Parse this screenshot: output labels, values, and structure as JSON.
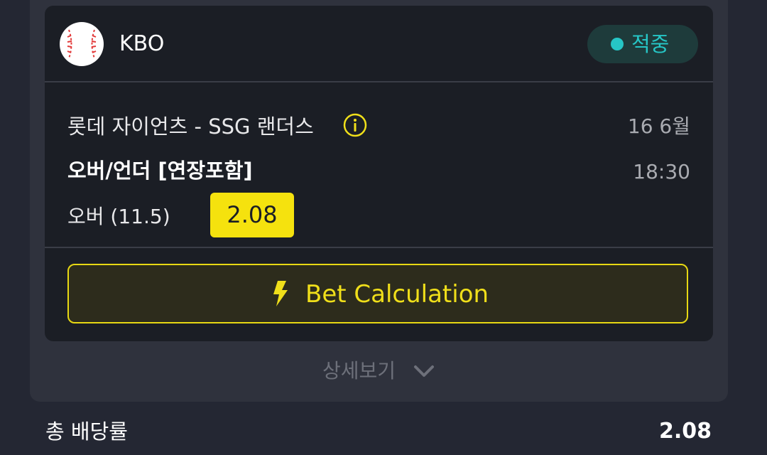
{
  "league": {
    "name": "KBO",
    "icon": "baseball-icon",
    "status": {
      "label": "적중",
      "color": "#26c6c6"
    }
  },
  "match": {
    "title": "롯데 자이언츠 - SSG 랜더스",
    "date": "16 6월",
    "time": "18:30",
    "market": "오버/언더 [연장포함]",
    "selection": "오버 (11.5)",
    "odds": "2.08"
  },
  "actions": {
    "bet_calculation_label": "Bet Calculation",
    "details_label": "상세보기"
  },
  "summary": {
    "total_odds_label": "총 배당률",
    "total_odds_value": "2.08"
  },
  "colors": {
    "accent": "#f5e20e",
    "success": "#26c6c6",
    "background": "#242733",
    "card": "#1b1e25"
  }
}
